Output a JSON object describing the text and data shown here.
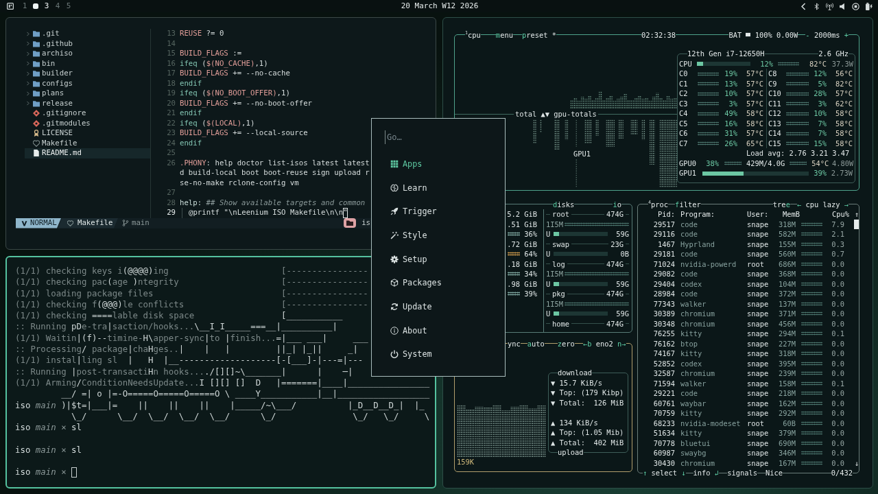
{
  "topbar": {
    "workspaces": [
      {
        "label": "1",
        "selected": false,
        "occupied": false
      },
      {
        "selected": true,
        "occupied": true
      },
      {
        "label": "3",
        "selected": false,
        "occupied": true
      },
      {
        "label": "4",
        "selected": false,
        "occupied": false
      },
      {
        "label": "5",
        "selected": false,
        "occupied": false
      }
    ],
    "clock": "20 March W12 2026"
  },
  "editor": {
    "tree": [
      {
        "name": ".git",
        "kind": "folder",
        "selected": false
      },
      {
        "name": ".github",
        "kind": "folder",
        "selected": false
      },
      {
        "name": "archiso",
        "kind": "folder",
        "selected": false
      },
      {
        "name": "bin",
        "kind": "folder",
        "selected": false
      },
      {
        "name": "builder",
        "kind": "folder",
        "selected": false
      },
      {
        "name": "configs",
        "kind": "folder",
        "selected": false
      },
      {
        "name": "plans",
        "kind": "folder",
        "selected": false
      },
      {
        "name": "release",
        "kind": "folder",
        "selected": false
      },
      {
        "name": ".gitignore",
        "kind": "git",
        "selected": false
      },
      {
        "name": ".gitmodules",
        "kind": "git",
        "selected": false
      },
      {
        "name": "LICENSE",
        "kind": "license",
        "selected": false
      },
      {
        "name": "Makefile",
        "kind": "makefile",
        "selected": false
      },
      {
        "name": "README.md",
        "kind": "readme",
        "selected": true
      }
    ],
    "lines": [
      {
        "number": "13",
        "current": false,
        "segments": [
          {
            "kind": "var",
            "text": "REUSE"
          },
          {
            "kind": "plain",
            "text": " ?= 0"
          }
        ]
      },
      {
        "number": "14",
        "current": false
      },
      {
        "number": "15",
        "current": false,
        "segments": [
          {
            "kind": "var",
            "text": "BUILD_FLAGS"
          },
          {
            "kind": "plain",
            "text": " :="
          }
        ]
      },
      {
        "number": "16",
        "current": false,
        "segments": [
          {
            "kind": "kw",
            "text": "ifeq"
          },
          {
            "kind": "plain",
            "text": " ("
          },
          {
            "kind": "var",
            "text": "$(NO_CACHE)"
          },
          {
            "kind": "plain",
            "text": ",1)"
          }
        ]
      },
      {
        "number": "17",
        "current": false,
        "segments": [
          {
            "kind": "var",
            "text": "BUILD_FLAGS"
          },
          {
            "kind": "plain",
            "text": " += --no-cache"
          }
        ]
      },
      {
        "number": "18",
        "current": false,
        "segments": [
          {
            "kind": "kw",
            "text": "endif"
          }
        ]
      },
      {
        "number": "19",
        "current": false,
        "segments": [
          {
            "kind": "kw",
            "text": "ifeq"
          },
          {
            "kind": "plain",
            "text": " ("
          },
          {
            "kind": "var",
            "text": "$(NO_BOOT_OFFER)"
          },
          {
            "kind": "plain",
            "text": ",1)"
          }
        ]
      },
      {
        "number": "20",
        "current": false,
        "segments": [
          {
            "kind": "var",
            "text": "BUILD_FLAGS"
          },
          {
            "kind": "plain",
            "text": " += --no-boot-offer"
          }
        ]
      },
      {
        "number": "21",
        "current": false,
        "segments": [
          {
            "kind": "kw",
            "text": "endif"
          }
        ]
      },
      {
        "number": "22",
        "current": false,
        "segments": [
          {
            "kind": "kw",
            "text": "ifeq"
          },
          {
            "kind": "plain",
            "text": " ("
          },
          {
            "kind": "var",
            "text": "$(LOCAL)"
          },
          {
            "kind": "plain",
            "text": ",1)"
          }
        ]
      },
      {
        "number": "23",
        "current": false,
        "segments": [
          {
            "kind": "var",
            "text": "BUILD_FLAGS"
          },
          {
            "kind": "plain",
            "text": " += --local-source"
          }
        ]
      },
      {
        "number": "24",
        "current": false,
        "segments": [
          {
            "kind": "kw",
            "text": "endif"
          }
        ]
      },
      {
        "number": "25",
        "current": false
      },
      {
        "number": "26",
        "current": false,
        "segments": [
          {
            "kind": "var",
            "text": ".PHONY"
          },
          {
            "kind": "plain",
            "text": ": help doctor list-isos latest latest"
          }
        ]
      },
      {
        "segments": [
          {
            "kind": "plain",
            "text": "d build-local boot boot-reuse sign upload r"
          }
        ]
      },
      {
        "segments": [
          {
            "kind": "plain",
            "text": "se-no-make rclone-config vm"
          }
        ]
      },
      {
        "number": "27",
        "current": false
      },
      {
        "number": "28",
        "current": false,
        "segments": [
          {
            "kind": "target",
            "text": "help:"
          },
          {
            "kind": "comment",
            "text": " ## Show available targets and common"
          }
        ]
      },
      {
        "number": "29",
        "current": true,
        "segments": [
          {
            "kind": "indent"
          },
          {
            "kind": "plain",
            "text": "@printf \"\\nLeenium ISO Makefile\\n\\n"
          },
          {
            "kind": "cursor",
            "text": "\""
          }
        ]
      }
    ],
    "statusline": {
      "mode": "NORMAL",
      "file": "Makefile",
      "branch": "main",
      "cwd": "is"
    }
  },
  "terminal": {
    "rows": [
      {
        "kind": "line",
        "segments": [
          {
            "kind": "dim",
            "text": "(1/1) checking keys i"
          },
          {
            "kind": "art",
            "text": "(@@@@)"
          },
          {
            "kind": "dim",
            "text": "ing                      [----------------"
          }
        ]
      },
      {
        "kind": "line",
        "segments": [
          {
            "kind": "dim",
            "text": "(1/1) checking pac"
          },
          {
            "kind": "art",
            "text": "("
          },
          {
            "kind": "dim",
            "text": "age "
          },
          {
            "kind": "art",
            "text": ")"
          },
          {
            "kind": "dim",
            "text": "ntegrity                    [----------------"
          }
        ]
      },
      {
        "kind": "line",
        "segments": [
          {
            "kind": "dim",
            "text": "(1/1) loading package files                         [----------------"
          }
        ]
      },
      {
        "kind": "line",
        "segments": [
          {
            "kind": "dim",
            "text": "(1/1) checking f"
          },
          {
            "kind": "art",
            "text": "(@@@)"
          },
          {
            "kind": "dim",
            "text": "le conflicts                   [----------------"
          }
        ]
      },
      {
        "kind": "line",
        "segments": [
          {
            "kind": "dim",
            "text": "(1/1) checking "
          },
          {
            "kind": "art",
            "text": "===="
          },
          {
            "kind": "dim",
            "text": "lable disk space                 "
          },
          {
            "kind": "art",
            "text": "[___________"
          }
        ]
      },
      {
        "kind": "line",
        "segments": [
          {
            "kind": "dim",
            "text": ":: Running "
          },
          {
            "kind": "art",
            "text": "pD"
          },
          {
            "kind": "dim",
            "text": "e-tra"
          },
          {
            "kind": "art",
            "text": "|"
          },
          {
            "kind": "dim",
            "text": "saction/hooks..."
          },
          {
            "kind": "art",
            "text": "\\__I_I_____===__|__________|"
          }
        ]
      },
      {
        "kind": "line",
        "segments": [
          {
            "kind": "dim",
            "text": "(1/1) Waitin"
          },
          {
            "kind": "art",
            "text": "|(f)--"
          },
          {
            "kind": "dim",
            "text": "timine-"
          },
          {
            "kind": "art",
            "text": "H\\"
          },
          {
            "kind": "dim",
            "text": "apper-sync"
          },
          {
            "kind": "art",
            "text": "|"
          },
          {
            "kind": "dim",
            "text": "to "
          },
          {
            "kind": "art",
            "text": "|"
          },
          {
            "kind": "dim",
            "text": "finish..."
          },
          {
            "kind": "art",
            "text": "=|___ ___|     ___"
          }
        ]
      },
      {
        "kind": "line",
        "segments": [
          {
            "kind": "dim",
            "text": ":: Processing"
          },
          {
            "kind": "art",
            "text": "/"
          },
          {
            "kind": "dim",
            "text": " package"
          },
          {
            "kind": "art",
            "text": "|"
          },
          {
            "kind": "dim",
            "text": "cha"
          },
          {
            "kind": "art",
            "text": "H"
          },
          {
            "kind": "dim",
            "text": "ges.."
          },
          {
            "kind": "art",
            "text": "|    |   |         ||_| |_||     _|"
          }
        ]
      },
      {
        "kind": "line",
        "segments": [
          {
            "kind": "dim",
            "text": "(1/1) instal"
          },
          {
            "kind": "art",
            "text": "|"
          },
          {
            "kind": "dim",
            "text": "ling sl"
          },
          {
            "kind": "art",
            "text": "  |   H  |__-------------------[-[___]-|---=|---"
          }
        ]
      },
      {
        "kind": "line",
        "segments": [
          {
            "kind": "dim",
            "text": ":: Running "
          },
          {
            "kind": "art",
            "text": "|"
          },
          {
            "kind": "dim",
            "text": "post-transacti"
          },
          {
            "kind": "art",
            "text": "H"
          },
          {
            "kind": "dim",
            "text": "n hooks..."
          },
          {
            "kind": "art",
            "text": "./[][]~\\_______|      |    ─|"
          }
        ]
      },
      {
        "kind": "line",
        "segments": [
          {
            "kind": "dim",
            "text": "(1/1) Arming"
          },
          {
            "kind": "art",
            "text": "/"
          },
          {
            "kind": "dim",
            "text": "ConditionNeedsUpdate..."
          },
          {
            "kind": "art",
            "text": "I [][] []  D   |=======|____|________________"
          }
        ]
      },
      {
        "kind": "line",
        "segments": [
          {
            "kind": "art",
            "text": "         __/ =| o |=-O=====O=====O=====O \\ ____Y___________|__|__________________"
          }
        ]
      },
      {
        "kind": "line",
        "segments": [
          {
            "kind": "path",
            "text": "iso"
          },
          {
            "kind": "branch",
            "text": " main"
          },
          {
            "kind": "art",
            "text": " )|$t=|___|=    ||    ||    ||    |_____/~\\___/          |_D__D__D_|  |_"
          }
        ]
      },
      {
        "kind": "line",
        "segments": [
          {
            "kind": "art",
            "text": "           \\_/      \\__/  \\__/  \\__/  \\__/      \\_/               \\_/   \\_/     \\"
          }
        ]
      },
      {
        "kind": "line",
        "segments": [
          {
            "kind": "path",
            "text": "iso"
          },
          {
            "kind": "branch",
            "text": " main"
          },
          {
            "kind": "mark",
            "text": " ×"
          },
          {
            "kind": "cmd",
            "text": " sl"
          }
        ]
      },
      {
        "kind": "blank"
      },
      {
        "kind": "line",
        "segments": [
          {
            "kind": "path",
            "text": "iso"
          },
          {
            "kind": "branch",
            "text": " main"
          },
          {
            "kind": "mark",
            "text": " ×"
          },
          {
            "kind": "cmd",
            "text": " sl"
          }
        ]
      },
      {
        "kind": "blank"
      },
      {
        "kind": "line",
        "segments": [
          {
            "kind": "path",
            "text": "iso"
          },
          {
            "kind": "branch",
            "text": " main"
          },
          {
            "kind": "mark",
            "text": " ×"
          },
          {
            "kind": "cursor"
          }
        ]
      }
    ]
  },
  "launcher": {
    "search": {
      "placeholder": "Go…"
    },
    "items": [
      {
        "label": "Apps",
        "kind": "grid",
        "selected": true
      },
      {
        "label": "Learn",
        "kind": "brain",
        "selected": false
      },
      {
        "label": "Trigger",
        "kind": "rocket",
        "selected": false
      },
      {
        "label": "Style",
        "kind": "wand",
        "selected": false
      },
      {
        "label": "Setup",
        "kind": "gear",
        "selected": false
      },
      {
        "label": "Packages",
        "kind": "cube",
        "selected": false
      },
      {
        "label": "Update",
        "kind": "refresh",
        "selected": false
      },
      {
        "label": "About",
        "kind": "info",
        "selected": false
      },
      {
        "label": "System",
        "kind": "power",
        "selected": false
      }
    ]
  },
  "btop": {
    "cpu_box": {
      "titles": [
        "$^{1}$cpu",
        "**m**enu",
        "**p**reset *"
      ],
      "clock": "02:32:38",
      "battery": {
        "label": "BAT",
        "reading": "100% 0.00W"
      },
      "interval": [
        "-",
        "2000ms",
        "+"
      ],
      "graph_labels": {
        "divider": "total ▲▼ gpu-totals",
        "lower": "GPU1"
      },
      "info": {
        "model": "12th Gen i7-12650H",
        "freq": "2.6 GHz",
        "total": {
          "label": "CPU",
          "level": 0.12,
          "percent": "12%",
          "temp": "82°C",
          "power": "37.3W"
        },
        "cores": [
          {
            "label": "C0",
            "percent": "19%",
            "temp": "57°C"
          },
          {
            "label": "C1",
            "percent": "13%",
            "temp": "57°C"
          },
          {
            "label": "C2",
            "percent": "10%",
            "temp": "57°C"
          },
          {
            "label": "C3",
            "percent": "3%",
            "temp": "57°C"
          },
          {
            "label": "C4",
            "percent": "49%",
            "temp": "58°C"
          },
          {
            "label": "C5",
            "percent": "16%",
            "temp": "58°C"
          },
          {
            "label": "C6",
            "percent": "31%",
            "temp": "57°C"
          },
          {
            "label": "C7",
            "percent": "26%",
            "temp": "65°C"
          },
          {
            "label": "C8",
            "percent": "12%",
            "temp": "56°C"
          },
          {
            "label": "C9",
            "percent": "5%",
            "temp": "82°C"
          },
          {
            "label": "C10",
            "percent": "28%",
            "temp": "57°C"
          },
          {
            "label": "C11",
            "percent": "3%",
            "temp": "62°C"
          },
          {
            "label": "C12",
            "percent": "10%",
            "temp": "58°C"
          },
          {
            "label": "C13",
            "percent": "7%",
            "temp": "58°C"
          },
          {
            "label": "C14",
            "percent": "7%",
            "temp": "58°C"
          },
          {
            "label": "C15",
            "percent": "15%",
            "temp": "58°C"
          }
        ],
        "load": {
          "label": "Load avg:",
          "values": [
            "2.76",
            "3.21",
            "3.47"
          ]
        },
        "gpus": [
          {
            "kind": "detail",
            "label": "GPU0",
            "percent": "38%",
            "memory": "429M/4.0G",
            "temp": "54°C",
            "power": "4.80W"
          },
          {
            "kind": "bar",
            "label": "GPU1",
            "level": 0.39,
            "percent": "39%",
            "power": "2.73W"
          }
        ]
      }
    },
    "mem_box": {
      "rows": [
        {
          "kind": "size",
          "text": "5.2 GiB"
        },
        {
          "kind": "size",
          "text": ".51 GiB"
        },
        {
          "kind": "meter",
          "text": "36%",
          "color": "#7fa8a0"
        },
        {
          "kind": "size",
          "text": ".72 GiB"
        },
        {
          "kind": "meter",
          "text": "64%",
          "color": "#c8964a"
        },
        {
          "kind": "size",
          "text": ".18 GiB"
        },
        {
          "kind": "meter",
          "text": "34%",
          "color": "#7fa8a0"
        },
        {
          "kind": "size",
          "text": ".98 GiB"
        },
        {
          "kind": "meter",
          "text": "39%",
          "color": "#7fa8a0"
        }
      ],
      "disks_titles": [
        "**d**isks",
        "**i**o"
      ],
      "disks": [
        {
          "name": "root",
          "size": "474G",
          "io": "1I5M",
          "used_label": "U",
          "used": "59G",
          "level": 0.1
        },
        {
          "name": "swap",
          "size": "23G",
          "used_label": "U",
          "used": "0B",
          "level": 0
        },
        {
          "name": "log",
          "size": "474G",
          "io": "1I5M",
          "used_label": "U",
          "used": "59G",
          "level": 0.1
        },
        {
          "name": "pkg",
          "size": "474G",
          "io": "1I5M",
          "used_label": "U",
          "used": "59G",
          "level": 0.1
        },
        {
          "name": "home",
          "size": "474G"
        }
      ]
    },
    "net_box": {
      "titles": [
        "ync",
        "**a**uto",
        "**z**ero"
      ],
      "interface": [
        "←b",
        "eno2",
        "n→"
      ],
      "scale": "159K",
      "download": {
        "title": "download",
        "rows": [
          "▼ 15.7 KiB/s",
          "▼ Top: (179 Kibp)",
          "▼ Total:  126 MiB"
        ]
      },
      "upload": {
        "title": "upload",
        "rows": [
          "▲ 134 KiB/s",
          "▲ Top: (1.05 Mib)",
          "▲ Total:  402 MiB"
        ]
      }
    },
    "proc_box": {
      "titles": [
        "$^{4}$proc",
        "**f**ilter",
        "tre**e**",
        "**←** cpu lazy **→**"
      ],
      "columns": [
        "Pid:",
        "Program:",
        "User:",
        "MemB",
        "Cpu%"
      ],
      "scroll_up": "↑",
      "scroll_down": "↓",
      "rows": [
        {
          "pid": "29517",
          "program": "code",
          "user": "snape",
          "mem": "318M",
          "cpu": "7.9"
        },
        {
          "pid": "29116",
          "program": "code",
          "user": "snape",
          "mem": "582M",
          "cpu": "2.1"
        },
        {
          "pid": "1467",
          "program": "Hyprland",
          "user": "snape",
          "mem": "155M",
          "cpu": "0.3"
        },
        {
          "pid": "29181",
          "program": "code",
          "user": "snape",
          "mem": "560M",
          "cpu": "0.7"
        },
        {
          "pid": "71024",
          "program": "nvidia-powerd",
          "user": "root",
          "mem": "686M",
          "cpu": "0.0"
        },
        {
          "pid": "29082",
          "program": "code",
          "user": "snape",
          "mem": "368M",
          "cpu": "0.0"
        },
        {
          "pid": "29404",
          "program": "codex",
          "user": "snape",
          "mem": "104M",
          "cpu": "0.0"
        },
        {
          "pid": "28984",
          "program": "code",
          "user": "snape",
          "mem": "372M",
          "cpu": "0.0"
        },
        {
          "pid": "77343",
          "program": "walker",
          "user": "snape",
          "mem": "137M",
          "cpu": "0.0"
        },
        {
          "pid": "30389",
          "program": "chromium",
          "user": "snape",
          "mem": "371M",
          "cpu": "0.0"
        },
        {
          "pid": "30348",
          "program": "chromium",
          "user": "snape",
          "mem": "456M",
          "cpu": "0.0"
        },
        {
          "pid": "76255",
          "program": "kitty",
          "user": "snape",
          "mem": "294M",
          "cpu": "0.1"
        },
        {
          "pid": "76162",
          "program": "btop",
          "user": "snape",
          "mem": "227M",
          "cpu": "0.0"
        },
        {
          "pid": "74167",
          "program": "kitty",
          "user": "snape",
          "mem": "318M",
          "cpu": "0.0"
        },
        {
          "pid": "52852",
          "program": "codex",
          "user": "snape",
          "mem": "395M",
          "cpu": "0.0"
        },
        {
          "pid": "32587",
          "program": "chromium",
          "user": "snape",
          "mem": "239M",
          "cpu": "0.0"
        },
        {
          "pid": "71594",
          "program": "walker",
          "user": "snape",
          "mem": "158M",
          "cpu": "0.1"
        },
        {
          "pid": "29221",
          "program": "code",
          "user": "snape",
          "mem": "218M",
          "cpu": "0.0"
        },
        {
          "pid": "60761",
          "program": "waybar",
          "user": "snape",
          "mem": "162M",
          "cpu": "0.0"
        },
        {
          "pid": "70759",
          "program": "kitty",
          "user": "snape",
          "mem": "292M",
          "cpu": "0.0"
        },
        {
          "pid": "68233",
          "program": "nvidia-modeset",
          "user": "root",
          "mem": "60B",
          "cpu": "0.0"
        },
        {
          "pid": "51634",
          "program": "kitty",
          "user": "snape",
          "mem": "379M",
          "cpu": "0.0"
        },
        {
          "pid": "70778",
          "program": "bluetui",
          "user": "snape",
          "mem": "690M",
          "cpu": "0.0"
        },
        {
          "pid": "60987",
          "program": "swaybg",
          "user": "snape",
          "mem": "346M",
          "cpu": "0.0"
        },
        {
          "pid": "30430",
          "program": "chromium",
          "user": "snape",
          "mem": "167M",
          "cpu": "0.0"
        }
      ],
      "footer": [
        "**↑** select **↓**",
        "info **↲**",
        "signals",
        "Nice",
        "0/432"
      ]
    }
  }
}
